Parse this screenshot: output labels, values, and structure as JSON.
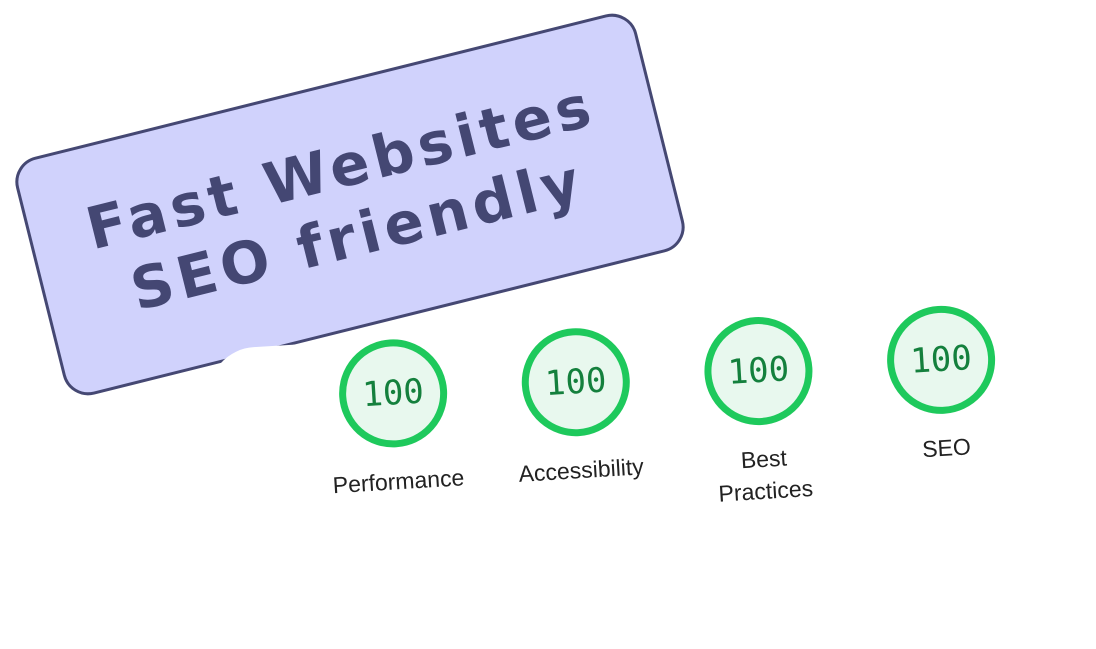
{
  "badge": {
    "line1": "Fast Websites",
    "line2": "SEO friendly"
  },
  "gauges": [
    {
      "score": "100",
      "label": "Performance"
    },
    {
      "score": "100",
      "label": "Accessibility"
    },
    {
      "score": "100",
      "label": "Best\nPractices"
    },
    {
      "score": "100",
      "label": "SEO"
    }
  ],
  "colors": {
    "badge_fill": "#d0d2fc",
    "badge_text": "#444773",
    "gauge_ring": "#1ec95c",
    "gauge_fill": "#e8f8ee",
    "gauge_text": "#14803d"
  }
}
